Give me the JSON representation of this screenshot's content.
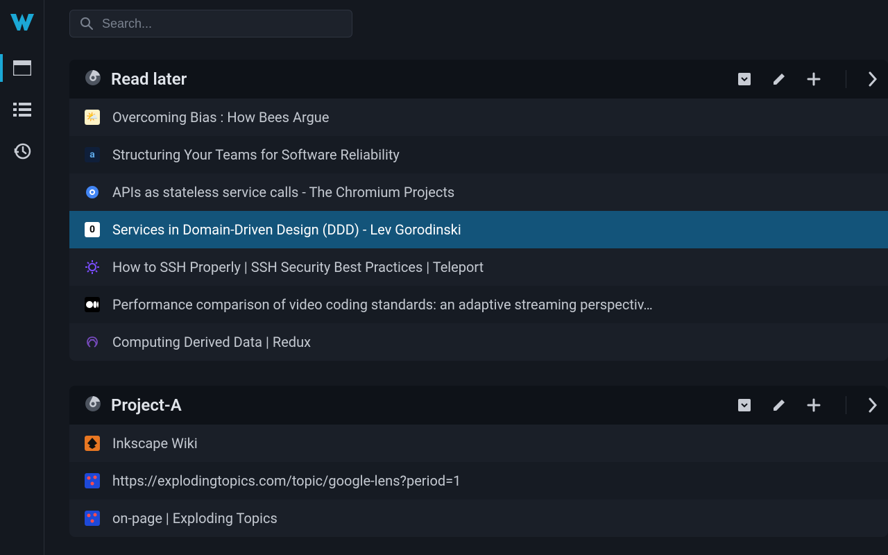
{
  "search": {
    "placeholder": "Search..."
  },
  "groups": [
    {
      "title": "Read later",
      "items": [
        {
          "label": "Overcoming Bias : How Bees Argue",
          "fvClass": "fv-yellow",
          "fvEmoji": "🌤️",
          "selected": false
        },
        {
          "label": "Structuring Your Teams for Software Reliability",
          "fvClass": "fv-dark",
          "fvText": "a",
          "fvTextColor": "#5da9e9",
          "selected": false
        },
        {
          "label": "APIs as stateless service calls - The Chromium Projects",
          "fvClass": "fv-none",
          "fvSvg": "chrome",
          "selected": false
        },
        {
          "label": "Services in Domain-Driven Design (DDD) - Lev Gorodinski",
          "fvClass": "fv-white",
          "fvText": "0",
          "fvTextColor": "#000",
          "selected": true
        },
        {
          "label": "How to SSH Properly | SSH Security Best Practices | Teleport",
          "fvClass": "fv-none",
          "fvSvg": "gear-purple",
          "selected": false
        },
        {
          "label": "Performance comparison of video coding standards: an adaptive streaming perspectiv…",
          "fvClass": "fv-black",
          "fvSvg": "medium",
          "selected": false
        },
        {
          "label": "Computing Derived Data | Redux",
          "fvClass": "fv-none",
          "fvSvg": "redux",
          "selected": false
        }
      ]
    },
    {
      "title": "Project-A",
      "items": [
        {
          "label": "Inkscape Wiki",
          "fvClass": "fv-orange",
          "fvSvg": "inkscape",
          "selected": false
        },
        {
          "label": "https://explodingtopics.com/topic/google-lens?period=1",
          "fvClass": "fv-blue",
          "fvSvg": "exploding",
          "selected": false
        },
        {
          "label": "on-page | Exploding Topics",
          "fvClass": "fv-blue",
          "fvSvg": "exploding",
          "selected": false
        }
      ]
    }
  ]
}
